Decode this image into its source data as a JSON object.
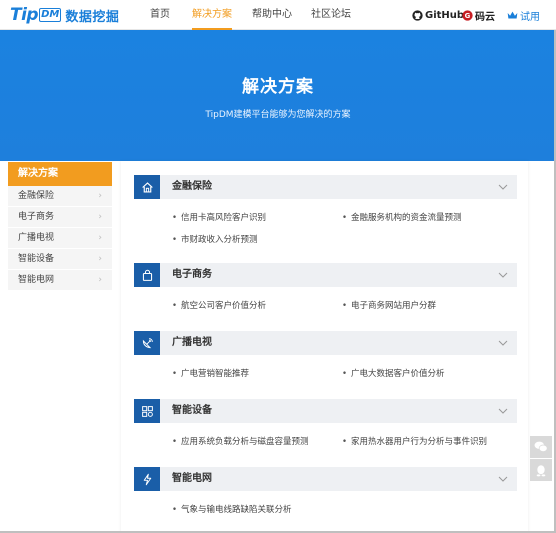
{
  "logo": {
    "brand": "Tip",
    "brand_box": "DM",
    "cn": "数据挖掘"
  },
  "nav": {
    "home": "首页",
    "solutions": "解决方案",
    "help": "帮助中心",
    "forum": "社区论坛"
  },
  "ext": {
    "github": "GitHub",
    "gitee": "码云",
    "trial": "试用"
  },
  "banner": {
    "title": "解决方案",
    "subtitle": "TipDM建模平台能够为您解决的方案"
  },
  "sidebar": {
    "heading": "解决方案",
    "items": [
      {
        "label": "金融保险"
      },
      {
        "label": "电子商务"
      },
      {
        "label": "广播电视"
      },
      {
        "label": "智能设备"
      },
      {
        "label": "智能电网"
      }
    ]
  },
  "sections": [
    {
      "title": "金融保险",
      "icon": "house-icon",
      "links": [
        "信用卡高风险客户识别",
        "金融服务机构的资金流量预测",
        "市财政收入分析预测"
      ]
    },
    {
      "title": "电子商务",
      "icon": "shopping-bag-icon",
      "links": [
        "航空公司客户价值分析",
        "电子商务网站用户分群"
      ]
    },
    {
      "title": "广播电视",
      "icon": "satellite-dish-icon",
      "links": [
        "广电营销智能推荐",
        "广电大数据客户价值分析"
      ]
    },
    {
      "title": "智能设备",
      "icon": "devices-icon",
      "links": [
        "应用系统负载分析与磁盘容量预测",
        "家用热水器用户行为分析与事件识别"
      ]
    },
    {
      "title": "智能电网",
      "icon": "lightning-icon",
      "links": [
        "气象与输电线路缺陷关联分析"
      ]
    }
  ],
  "colors": {
    "accent": "#f29c1f",
    "brand": "#1a7fd9",
    "section_icon_bg": "#1a5ea8"
  }
}
